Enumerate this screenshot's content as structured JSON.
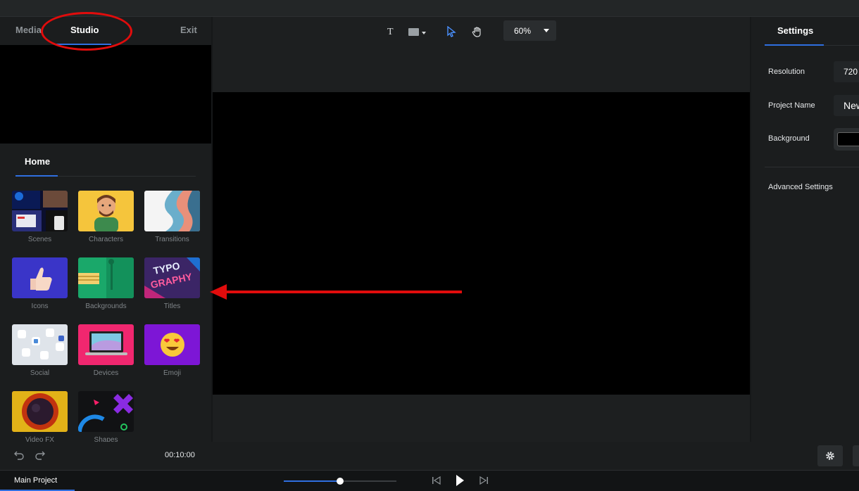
{
  "left_tabs": {
    "media": "Media",
    "studio": "Studio",
    "exit": "Exit"
  },
  "home_tab": "Home",
  "library": [
    {
      "label": "Scenes",
      "icon": "scenes-thumbnail"
    },
    {
      "label": "Characters",
      "icon": "characters-thumbnail"
    },
    {
      "label": "Transitions",
      "icon": "transitions-thumbnail"
    },
    {
      "label": "Icons",
      "icon": "icons-thumbnail"
    },
    {
      "label": "Backgrounds",
      "icon": "backgrounds-thumbnail"
    },
    {
      "label": "Titles",
      "icon": "titles-thumbnail",
      "art_text": "TYPO GRAPHY"
    },
    {
      "label": "Social",
      "icon": "social-thumbnail"
    },
    {
      "label": "Devices",
      "icon": "devices-thumbnail"
    },
    {
      "label": "Emoji",
      "icon": "emoji-thumbnail"
    },
    {
      "label": "Video FX",
      "icon": "video-fx-thumbnail"
    },
    {
      "label": "Shapes",
      "icon": "shapes-thumbnail"
    }
  ],
  "toolbar": {
    "text_tool": "T",
    "zoom": "60%"
  },
  "settings": {
    "tab": "Settings",
    "resolution_label": "Resolution",
    "resolution_value": "720",
    "project_name_label": "Project Name",
    "project_name_value": "New",
    "background_label": "Background",
    "background_color": "#000000",
    "advanced_label": "Advanced Settings"
  },
  "timeline": {
    "time": "00:10:00",
    "project_tab": "Main Project",
    "scrubber_progress": 0.5
  },
  "colors": {
    "accent": "#2f6fe0",
    "annotation": "#e10c0c"
  }
}
